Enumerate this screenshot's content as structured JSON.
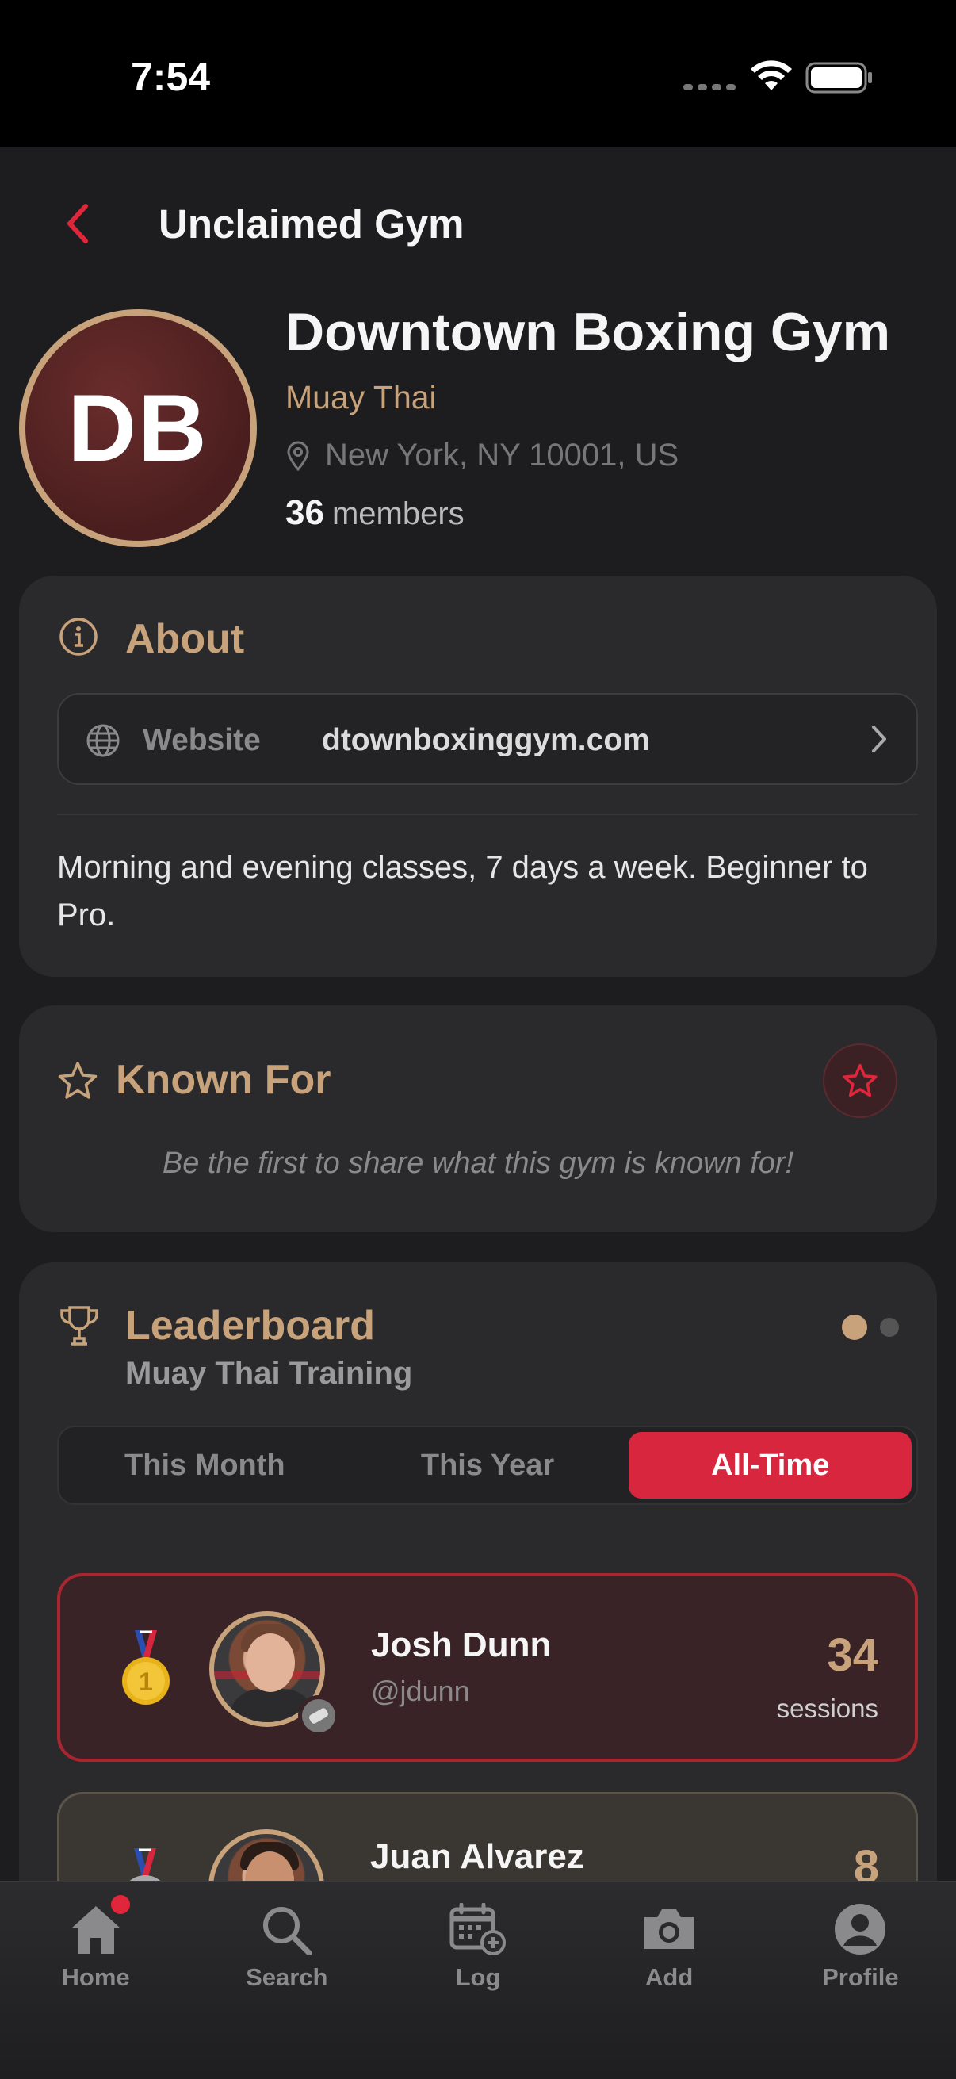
{
  "status_bar": {
    "time": "7:54"
  },
  "header": {
    "title": "Unclaimed Gym"
  },
  "gym": {
    "initials": "DB",
    "name": "Downtown Boxing Gym",
    "style": "Muay Thai",
    "location": "New York, NY 10001, US",
    "members_count": "36",
    "members_label": "members"
  },
  "about": {
    "title": "About",
    "website_label": "Website",
    "website_value": "dtownboxinggym.com",
    "description": "Morning and evening classes, 7 days a week. Beginner to Pro."
  },
  "known_for": {
    "title": "Known For",
    "empty_text": "Be the first to share what this gym is known for!"
  },
  "leaderboard": {
    "title": "Leaderboard",
    "subtitle": "Muay Thai Training",
    "tabs": [
      {
        "label": "This Month"
      },
      {
        "label": "This Year"
      },
      {
        "label": "All-Time",
        "active": true
      }
    ],
    "entries": [
      {
        "rank": "1",
        "name": "Josh Dunn",
        "handle": "@jdunn",
        "score": "34",
        "unit": "sessions"
      },
      {
        "rank": "2",
        "name": "Juan Alvarez",
        "handle": "",
        "score": "8",
        "unit": ""
      }
    ]
  },
  "tab_bar": {
    "items": [
      {
        "label": "Home",
        "icon": "home-icon",
        "badge": true
      },
      {
        "label": "Search",
        "icon": "search-icon"
      },
      {
        "label": "Log",
        "icon": "calendar-add-icon"
      },
      {
        "label": "Add",
        "icon": "camera-icon"
      },
      {
        "label": "Profile",
        "icon": "profile-icon"
      }
    ]
  },
  "colors": {
    "accent_gold": "#c7a27a",
    "accent_red": "#d7263d",
    "background": "#1d1d1f",
    "card": "#2a2a2c"
  }
}
